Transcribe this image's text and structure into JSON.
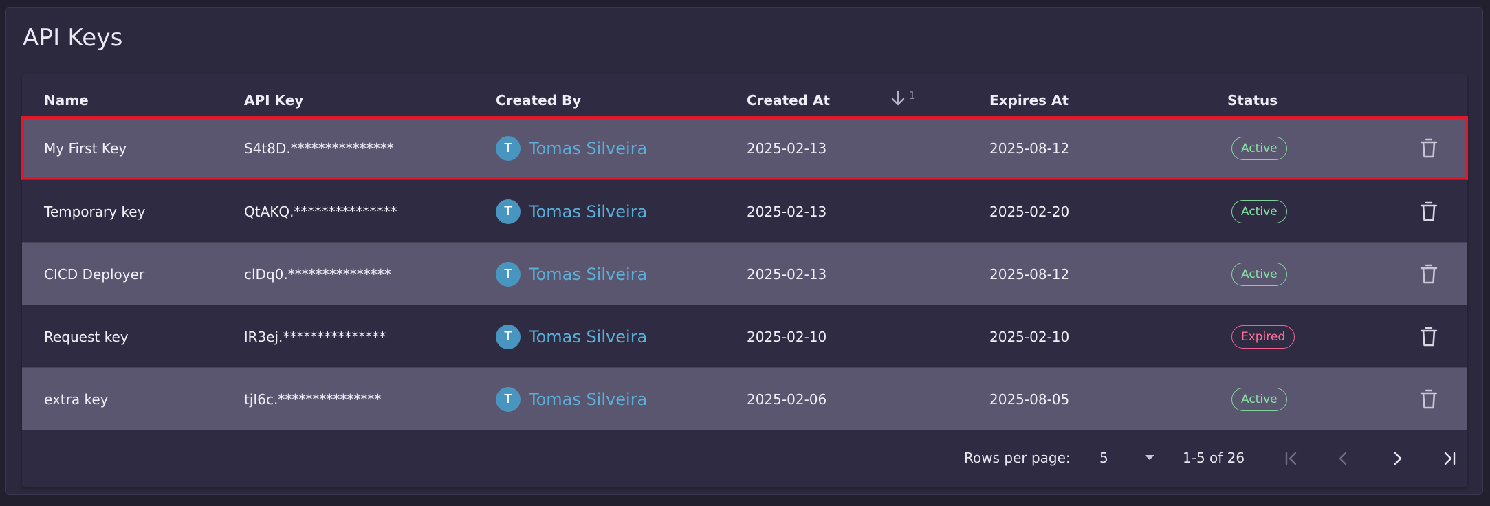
{
  "page": {
    "title": "API Keys"
  },
  "table": {
    "columns": {
      "name": "Name",
      "api_key": "API Key",
      "created_by": "Created By",
      "created_at": "Created At",
      "expires_at": "Expires At",
      "status": "Status"
    },
    "sort": {
      "column": "Created At",
      "priority": "1"
    },
    "rows": [
      {
        "name": "My First Key",
        "api_key": "S4t8D.***************",
        "avatar": "T",
        "created_by": "Tomas Silveira",
        "created_at": "2025-02-13",
        "expires_at": "2025-08-12",
        "status": "Active"
      },
      {
        "name": "Temporary key",
        "api_key": "QtAKQ.***************",
        "avatar": "T",
        "created_by": "Tomas Silveira",
        "created_at": "2025-02-13",
        "expires_at": "2025-02-20",
        "status": "Active"
      },
      {
        "name": "CICD Deployer",
        "api_key": "clDq0.***************",
        "avatar": "T",
        "created_by": "Tomas Silveira",
        "created_at": "2025-02-13",
        "expires_at": "2025-08-12",
        "status": "Active"
      },
      {
        "name": "Request key",
        "api_key": "lR3ej.***************",
        "avatar": "T",
        "created_by": "Tomas Silveira",
        "created_at": "2025-02-10",
        "expires_at": "2025-02-10",
        "status": "Expired"
      },
      {
        "name": "extra key",
        "api_key": "tjI6c.***************",
        "avatar": "T",
        "created_by": "Tomas Silveira",
        "created_at": "2025-02-06",
        "expires_at": "2025-08-05",
        "status": "Active"
      }
    ]
  },
  "pagination": {
    "rows_per_page_label": "Rows per page:",
    "rows_per_page_value": "5",
    "range": "1-5 of 26"
  },
  "colors": {
    "active": "#86e0a2",
    "expired": "#ff6f9a",
    "link": "#5aaed8",
    "highlight": "#e0182b"
  }
}
